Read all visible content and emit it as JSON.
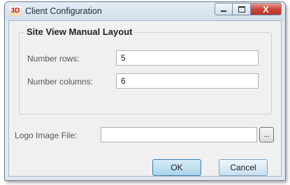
{
  "window": {
    "title": "Client Configuration",
    "app_icon_text": "3D",
    "close_glyph": "X"
  },
  "layout_group": {
    "legend": "Site View Manual Layout",
    "rows_label": "Number rows:",
    "rows_value": "5",
    "columns_label": "Number columns:",
    "columns_value": "6"
  },
  "logo": {
    "label": "Logo Image File:",
    "value": "",
    "browse_label": "..."
  },
  "buttons": {
    "ok": "OK",
    "cancel": "Cancel"
  }
}
